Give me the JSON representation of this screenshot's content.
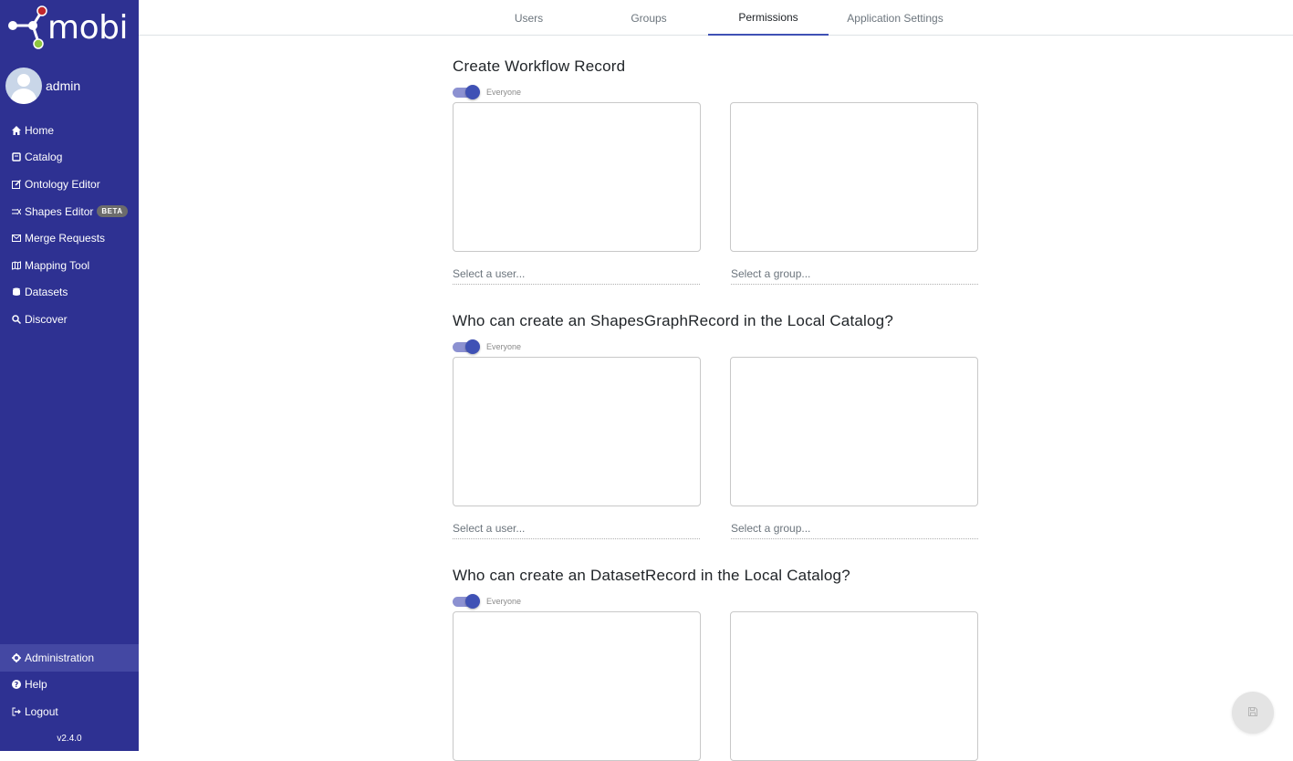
{
  "app": {
    "logo_text": "mobi",
    "version": "v2.4.0"
  },
  "user": {
    "name": "admin"
  },
  "sidebar": {
    "items": [
      {
        "label": "Home",
        "icon": "home-icon"
      },
      {
        "label": "Catalog",
        "icon": "book-icon"
      },
      {
        "label": "Ontology Editor",
        "icon": "edit-icon"
      },
      {
        "label": "Shapes Editor",
        "icon": "shapes-icon",
        "badge": "BETA"
      },
      {
        "label": "Merge Requests",
        "icon": "envelope-icon"
      },
      {
        "label": "Mapping Tool",
        "icon": "map-icon"
      },
      {
        "label": "Datasets",
        "icon": "database-icon"
      },
      {
        "label": "Discover",
        "icon": "search-icon"
      }
    ],
    "bottom_items": [
      {
        "label": "Administration",
        "icon": "gear-icon",
        "active": true
      },
      {
        "label": "Help",
        "icon": "question-circle-icon"
      },
      {
        "label": "Logout",
        "icon": "sign-out-icon"
      }
    ]
  },
  "tabs": [
    {
      "label": "Users"
    },
    {
      "label": "Groups"
    },
    {
      "label": "Permissions",
      "active": true
    },
    {
      "label": "Application Settings"
    }
  ],
  "permissions": [
    {
      "title": "Create Workflow Record",
      "toggle_label": "Everyone",
      "everyone": true,
      "user_placeholder": "Select a user...",
      "group_placeholder": "Select a group..."
    },
    {
      "title": "Who can create an ShapesGraphRecord in the Local Catalog?",
      "toggle_label": "Everyone",
      "everyone": true,
      "user_placeholder": "Select a user...",
      "group_placeholder": "Select a group..."
    },
    {
      "title": "Who can create an DatasetRecord in the Local Catalog?",
      "toggle_label": "Everyone",
      "everyone": true,
      "user_placeholder": "Select a user...",
      "group_placeholder": "Select a group..."
    }
  ],
  "colors": {
    "sidebar": "#2e3192",
    "accent": "#3f51b5",
    "toggle_track": "#8c91d1"
  },
  "fab": {
    "icon": "save-icon"
  }
}
